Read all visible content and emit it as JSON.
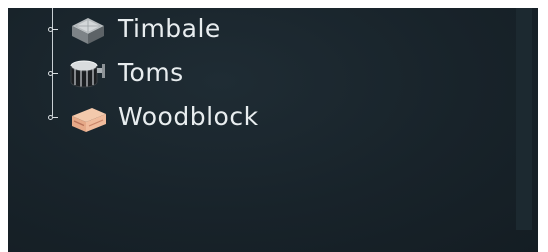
{
  "tree": {
    "items": [
      {
        "label": "Timbale",
        "icon": "timbale-icon"
      },
      {
        "label": "Toms",
        "icon": "tom-drum-icon"
      },
      {
        "label": "Woodblock",
        "icon": "woodblock-icon"
      }
    ]
  },
  "colors": {
    "background": "#18232a",
    "text": "#e8edef",
    "tree_line": "#c9d0d4",
    "scrollbar_track": "#1c2930"
  }
}
